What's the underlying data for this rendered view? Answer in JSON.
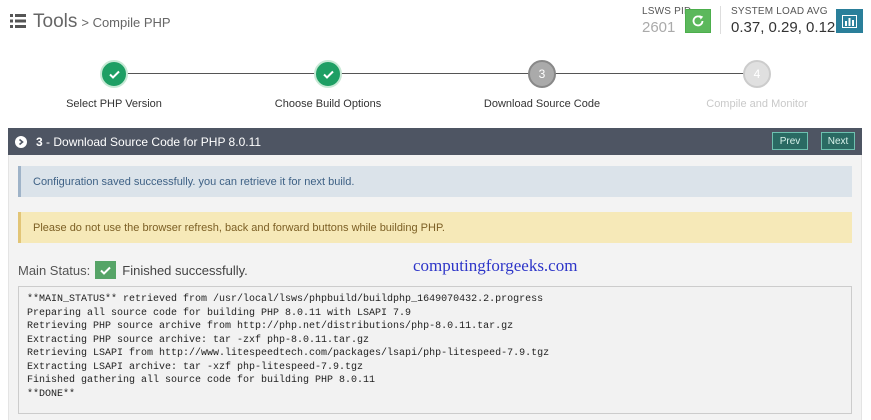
{
  "header": {
    "title": "Tools",
    "breadcrumb": "> Compile PHP",
    "lsws_pid_label": "LSWS PID",
    "lsws_pid_value": "2601",
    "load_label": "SYSTEM LOAD AVG",
    "load_value": "0.37, 0.29, 0.12",
    "icons": [
      "list-icon",
      "refresh-icon",
      "bar-chart-icon"
    ]
  },
  "steps": [
    {
      "label": "Select PHP Version",
      "state": "done",
      "number": ""
    },
    {
      "label": "Choose Build Options",
      "state": "done",
      "number": ""
    },
    {
      "label": "Download Source Code",
      "state": "current",
      "number": "3"
    },
    {
      "label": "Compile and Monitor",
      "state": "todo",
      "number": "4"
    }
  ],
  "panel": {
    "step_number": "3",
    "title": " - Download Source Code for PHP 8.0.11",
    "prev_label": "Prev",
    "next_label": "Next"
  },
  "alerts": {
    "info": "Configuration saved successfully. you can retrieve it for next build.",
    "warning": "Please do not use the browser refresh, back and forward buttons while building PHP."
  },
  "status": {
    "label": "Main Status:",
    "text": "Finished successfully."
  },
  "watermark": "computingforgeeks.com",
  "log_lines": [
    "**MAIN_STATUS** retrieved from /usr/local/lsws/phpbuild/buildphp_1649070432.2.progress",
    "Preparing all source code for building PHP 8.0.11 with LSAPI 7.9",
    "Retrieving PHP source archive from http://php.net/distributions/php-8.0.11.tar.gz",
    "Extracting PHP source archive: tar -zxf php-8.0.11.tar.gz",
    "Retrieving LSAPI from http://www.litespeedtech.com/packages/lsapi/php-litespeed-7.9.tgz",
    "Extracting LSAPI archive: tar -xzf php-litespeed-7.9.tgz",
    "Finished gathering all source code for building PHP 8.0.11",
    "**DONE**"
  ],
  "colors": {
    "done": "#1e9f64",
    "panel_header": "#4e5563",
    "success": "#56a467",
    "chart_button": "#2a7f9a"
  }
}
